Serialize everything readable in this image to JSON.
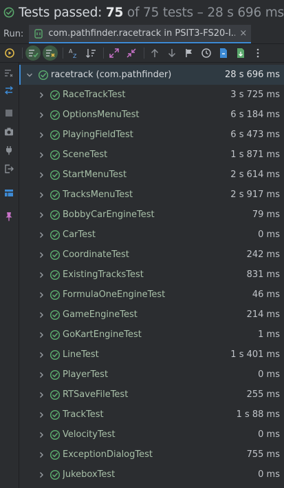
{
  "status": {
    "title": "Tests passed:",
    "passed": "75",
    "rest": "of 75 tests – 28 s 696 ms",
    "icon": "check-circle-icon",
    "color_pass": "#5aa86c"
  },
  "run_bar": {
    "label": "Run:",
    "tab_title": "com.pathfinder.racetrack in PSIT3-FS20-I...",
    "close_glyph": "×"
  },
  "toolbar": {
    "buttons": [
      "rerun-icon",
      "show-passed-icon",
      "show-ignored-icon",
      "sort-alpha-icon",
      "sort-duration-icon",
      "expand-all-icon",
      "collapse-all-icon",
      "prev-failed-icon",
      "next-failed-icon",
      "import-test-icon",
      "history-icon",
      "export-icon",
      "export-file-icon",
      "more-icon"
    ]
  },
  "left_strip": {
    "buttons": [
      "soft-wraps-icon",
      "swap-icon",
      "stop-icon",
      "camera-icon",
      "plug-icon",
      "exit-icon",
      "layout-icon",
      "pin-icon"
    ]
  },
  "tree": {
    "root": {
      "label": "racetrack (com.pathfinder)",
      "time": "28 s 696 ms"
    },
    "items": [
      {
        "label": "RaceTrackTest",
        "time": "3 s 725 ms"
      },
      {
        "label": "OptionsMenuTest",
        "time": "6 s 184 ms"
      },
      {
        "label": "PlayingFieldTest",
        "time": "6 s 473 ms"
      },
      {
        "label": "SceneTest",
        "time": "1 s 871 ms"
      },
      {
        "label": "StartMenuTest",
        "time": "2 s 614 ms"
      },
      {
        "label": "TracksMenuTest",
        "time": "2 s 917 ms"
      },
      {
        "label": "BobbyCarEngineTest",
        "time": "79 ms"
      },
      {
        "label": "CarTest",
        "time": "0 ms"
      },
      {
        "label": "CoordinateTest",
        "time": "242 ms"
      },
      {
        "label": "ExistingTracksTest",
        "time": "831 ms"
      },
      {
        "label": "FormulaOneEngineTest",
        "time": "46 ms"
      },
      {
        "label": "GameEngineTest",
        "time": "214 ms"
      },
      {
        "label": "GoKartEngineTest",
        "time": "1 ms"
      },
      {
        "label": "LineTest",
        "time": "1 s 401 ms"
      },
      {
        "label": "PlayerTest",
        "time": "0 ms"
      },
      {
        "label": "RTSaveFileTest",
        "time": "255 ms"
      },
      {
        "label": "TrackTest",
        "time": "1 s 88 ms"
      },
      {
        "label": "VelocityTest",
        "time": "0 ms"
      },
      {
        "label": "ExceptionDialogTest",
        "time": "755 ms"
      },
      {
        "label": "JukeboxTest",
        "time": "0 ms"
      }
    ]
  }
}
